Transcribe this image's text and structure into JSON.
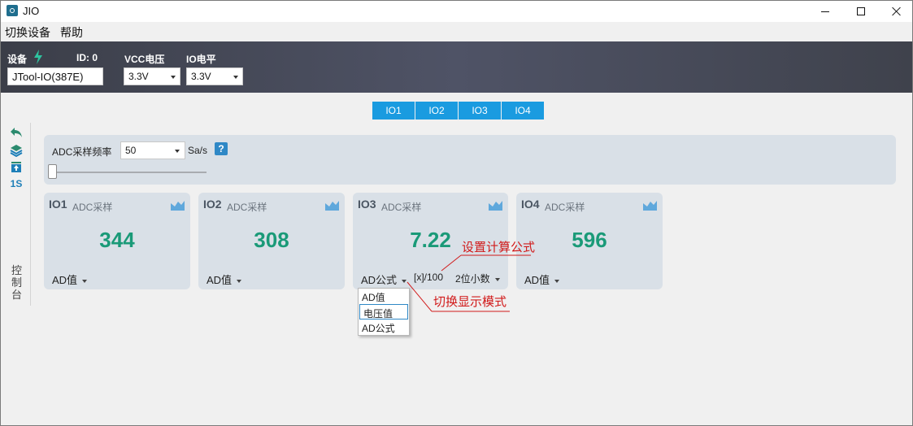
{
  "window": {
    "title": "JIO"
  },
  "menu": [
    "切换设备",
    "帮助"
  ],
  "header": {
    "device_label": "设备",
    "id_label": "ID: 0",
    "vcc_label": "VCC电压",
    "io_level_label": "IO电平",
    "device_value": "JTool-IO(387E)",
    "vcc_value": "3.3V",
    "io_level_value": "3.3V"
  },
  "tabs": [
    "IO1",
    "IO2",
    "IO3",
    "IO4"
  ],
  "toolbar": {
    "seconds_label": "1S",
    "console_label": "控制台"
  },
  "adc": {
    "label": "ADC采样频率",
    "rate": "50",
    "unit": "Sa/s",
    "help": "?",
    "slider_fraction": 0.0
  },
  "cards": [
    {
      "name": "IO1",
      "sub": "ADC采样",
      "value": "344",
      "mode": "AD值"
    },
    {
      "name": "IO2",
      "sub": "ADC采样",
      "value": "308",
      "mode": "AD值"
    },
    {
      "name": "IO3",
      "sub": "ADC采样",
      "value": "7.22",
      "mode": "AD公式",
      "formula": "[x]/100",
      "decimals": "2位小数"
    },
    {
      "name": "IO4",
      "sub": "ADC采样",
      "value": "596",
      "mode": "AD值"
    }
  ],
  "dropdown": [
    "AD值",
    "电压值",
    "AD公式"
  ],
  "annotations": {
    "formula_note": "设置计算公式",
    "mode_note": "切换显示模式"
  },
  "colors": {
    "accent": "#1a9be0",
    "value_green": "#1a9a78",
    "annotation_red": "#d11a1a"
  }
}
